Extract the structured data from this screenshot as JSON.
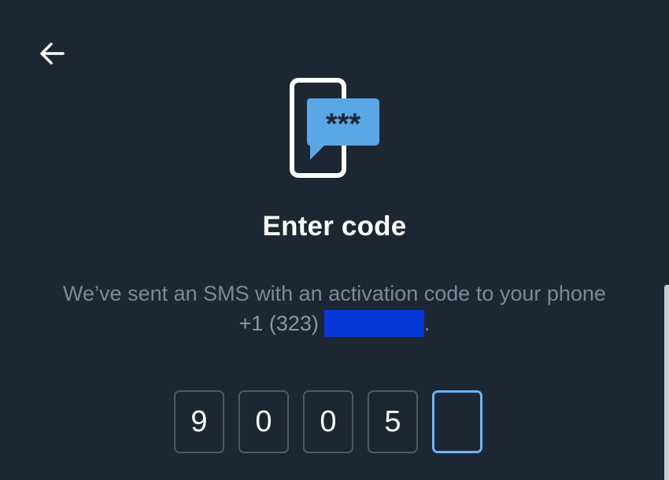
{
  "colors": {
    "background": "#1d2633",
    "accent": "#6cb4f4",
    "bubble": "#5aa7e6",
    "muted_text": "#7c8a9b",
    "redaction": "#0737d6"
  },
  "header": {
    "back_icon": "arrow-left-icon"
  },
  "illustration": {
    "icon": "sms-phone-icon",
    "bubble_text": "***"
  },
  "title": "Enter code",
  "description": {
    "line1": "We’ve sent an SMS with an activation code to your phone",
    "phone_prefix": "+1 (323)",
    "trailing": "."
  },
  "code": {
    "digits": [
      "9",
      "0",
      "0",
      "5",
      ""
    ]
  }
}
